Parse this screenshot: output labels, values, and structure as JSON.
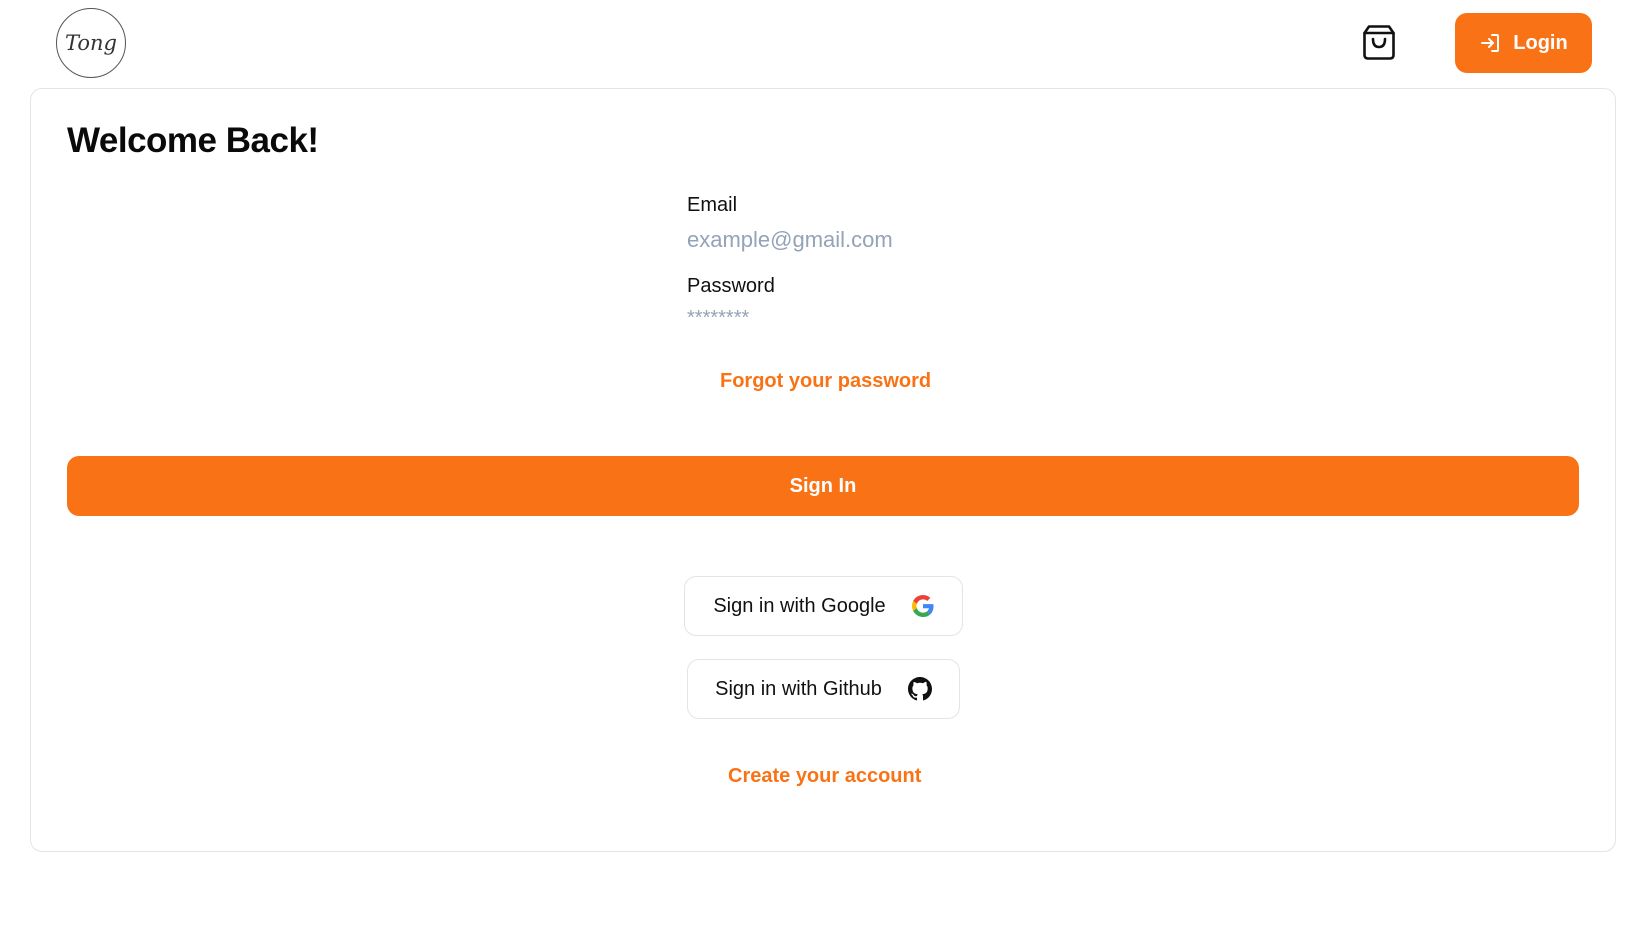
{
  "header": {
    "logo_text": "Tong",
    "login_label": "Login"
  },
  "form": {
    "title": "Welcome Back!",
    "email_label": "Email",
    "email_placeholder": "example@gmail.com",
    "password_label": "Password",
    "password_placeholder": "********",
    "forgot_label": "Forgot your password",
    "signin_label": "Sign In",
    "google_label": "Sign in with Google",
    "github_label": "Sign in with Github",
    "create_label": "Create your account"
  },
  "colors": {
    "accent": "#f97316",
    "border": "#e4e4e7",
    "placeholder": "#94a3b8"
  },
  "icons": {
    "cart": "shopping-bag-icon",
    "login": "login-arrow-icon",
    "google": "google-icon",
    "github": "github-icon"
  }
}
